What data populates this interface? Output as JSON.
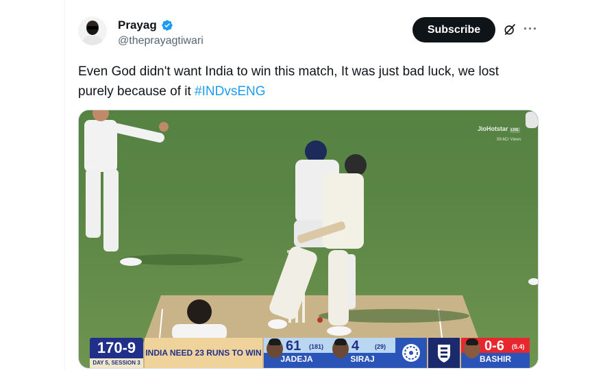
{
  "author": {
    "name": "Prayag",
    "handle": "@theprayagtiwari",
    "verified": true
  },
  "actions": {
    "subscribe_label": "Subscribe",
    "grok_icon": "grok-icon",
    "more_icon": "more-horizontal-icon"
  },
  "tweet": {
    "text": "Even God didn't want India to win this match, It was just bad luck, we lost purely because of it ",
    "hashtag": "#INDvsENG"
  },
  "media": {
    "watermark": "JioHotstar",
    "live_badge": "LIVE",
    "views": "59.6Cr Views",
    "scoreboard": {
      "score": "170-9",
      "session": "DAY 5, SESSION 3",
      "need": "INDIA NEED 23  RUNS TO WIN",
      "batter1": {
        "name": "JADEJA",
        "runs": "61",
        "balls": "(181)"
      },
      "batter2": {
        "name": "SIRAJ",
        "runs": "4",
        "balls": "(29)"
      },
      "bowler": {
        "name": "BASHIR",
        "figures": "0-6",
        "overs": "(5.4)"
      }
    }
  },
  "colors": {
    "accent": "#1d9bf0",
    "button_bg": "#0f1419",
    "pitch_green": "#5f8a4a"
  }
}
